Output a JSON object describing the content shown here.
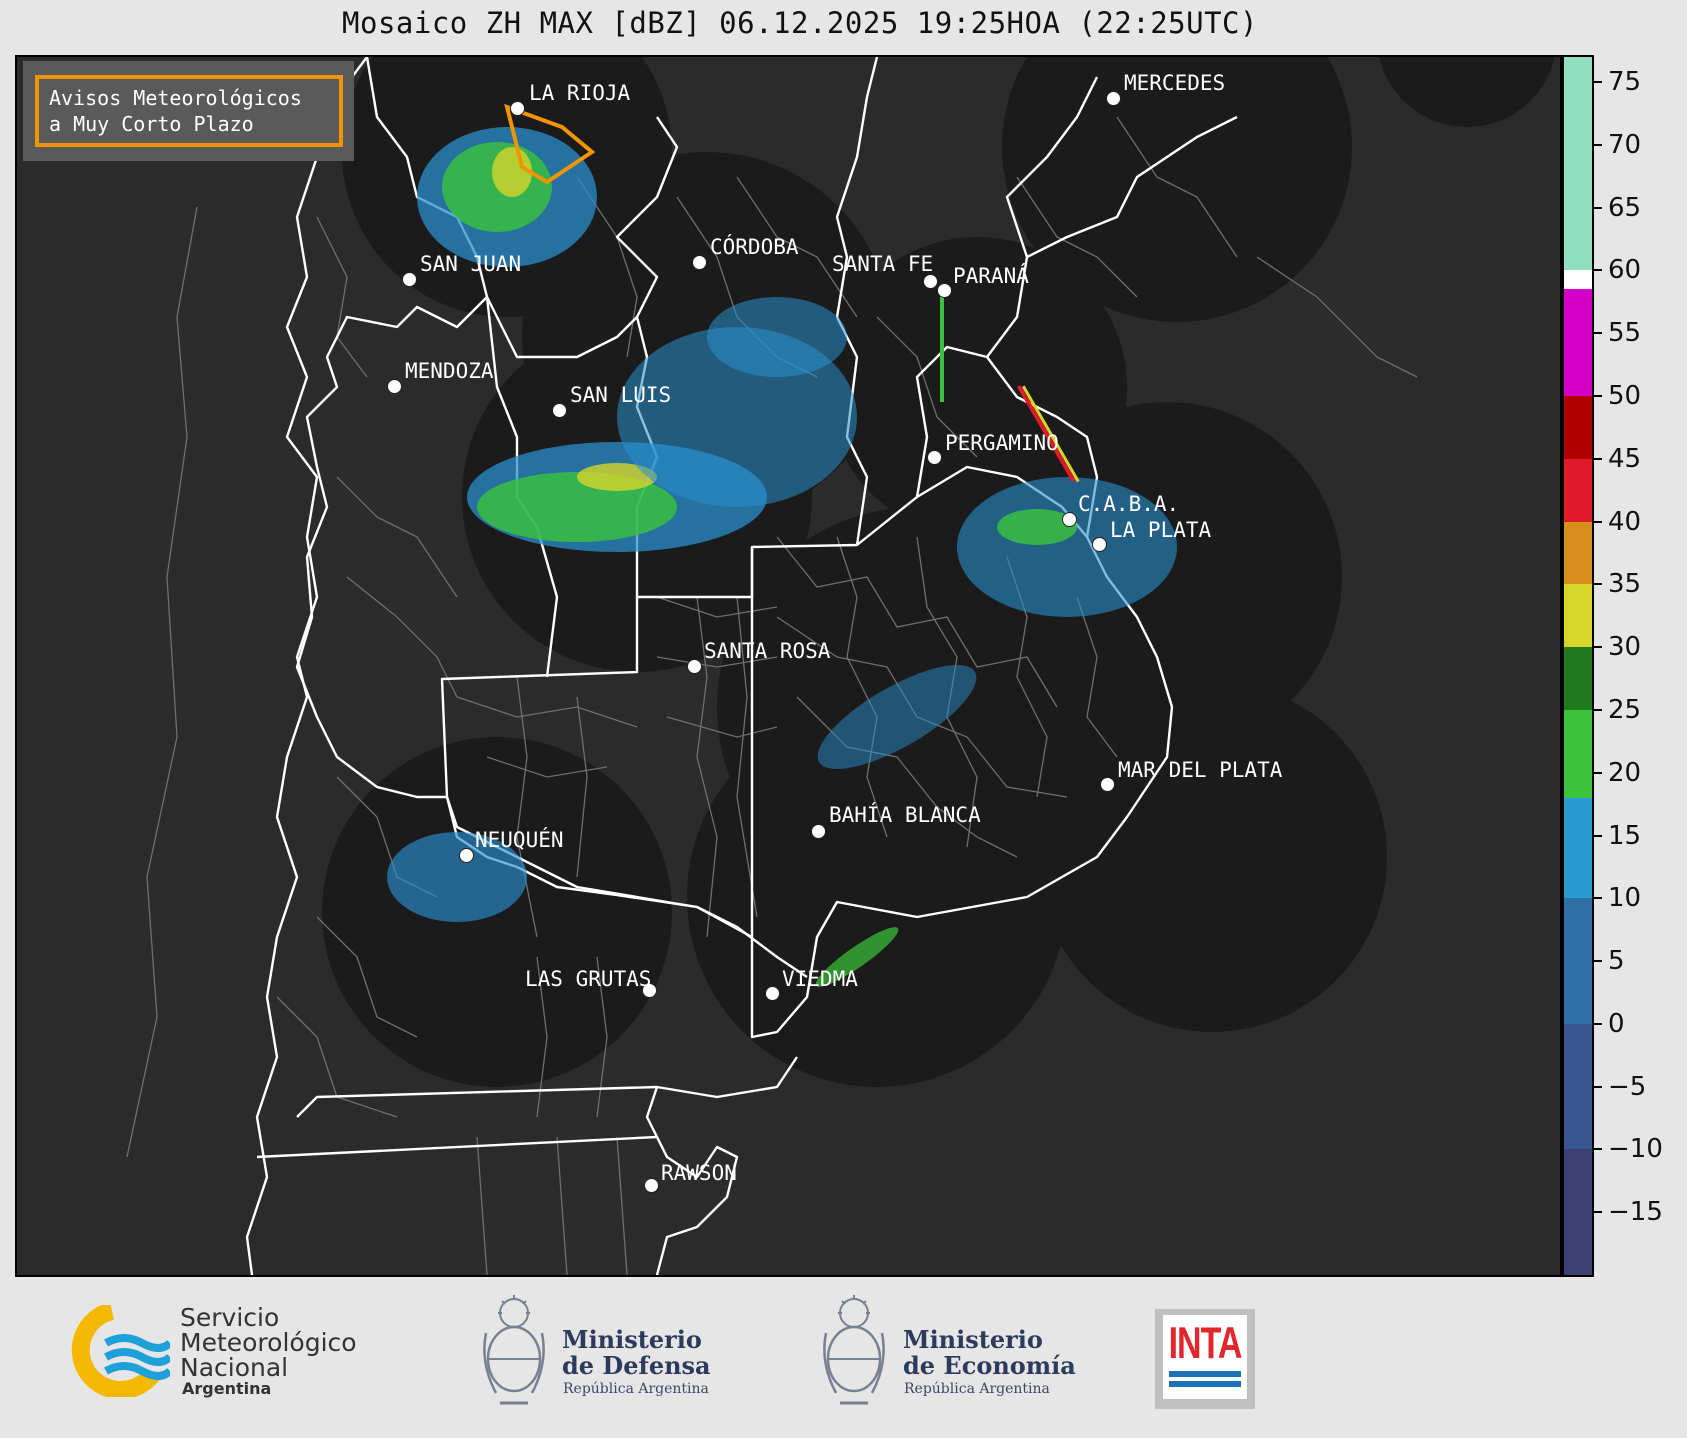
{
  "title": "Mosaico ZH MAX [dBZ] 06.12.2025 19:25HOA (22:25UTC)",
  "alert_box": {
    "line1": "Avisos Meteorológicos",
    "line2": "a Muy Corto Plazo",
    "border_color": "#f29400"
  },
  "cities": [
    {
      "name": "LA RIOJA"
    },
    {
      "name": "MERCEDES"
    },
    {
      "name": "CÓRDOBA"
    },
    {
      "name": "SAN JUAN"
    },
    {
      "name": "SANTA FE"
    },
    {
      "name": "PARANÁ"
    },
    {
      "name": "MENDOZA"
    },
    {
      "name": "SAN LUIS"
    },
    {
      "name": "PERGAMINO"
    },
    {
      "name": "C.A.B.A."
    },
    {
      "name": "LA PLATA"
    },
    {
      "name": "SANTA ROSA"
    },
    {
      "name": "MAR DEL PLATA"
    },
    {
      "name": "BAHÍA BLANCA"
    },
    {
      "name": "NEUQUÉN"
    },
    {
      "name": "LAS GRUTAS"
    },
    {
      "name": "VIEDMA"
    },
    {
      "name": "RAWSON"
    }
  ],
  "colorbar": {
    "unit": "dBZ",
    "min": -20,
    "max": 77,
    "ticks": [
      "75",
      "70",
      "65",
      "60",
      "55",
      "50",
      "45",
      "40",
      "35",
      "30",
      "25",
      "20",
      "15",
      "10",
      "5",
      "0",
      "−5",
      "−10",
      "−15"
    ],
    "tick_values": [
      75,
      70,
      65,
      60,
      55,
      50,
      45,
      40,
      35,
      30,
      25,
      20,
      15,
      10,
      5,
      0,
      -5,
      -10,
      -15
    ],
    "segments": [
      {
        "from": 60,
        "to": 77,
        "color": "#8fe0c0"
      },
      {
        "from": 58.5,
        "to": 60,
        "color": "#ffffff"
      },
      {
        "from": 50,
        "to": 58.5,
        "color": "#d400c8"
      },
      {
        "from": 45,
        "to": 50,
        "color": "#b00000"
      },
      {
        "from": 40,
        "to": 45,
        "color": "#e01a2a"
      },
      {
        "from": 35,
        "to": 40,
        "color": "#d88f1c"
      },
      {
        "from": 30,
        "to": 35,
        "color": "#d6d62a"
      },
      {
        "from": 25,
        "to": 30,
        "color": "#1f7a1f"
      },
      {
        "from": 18,
        "to": 25,
        "color": "#3bc43b"
      },
      {
        "from": 10,
        "to": 18,
        "color": "#2a9bd0"
      },
      {
        "from": 0,
        "to": 10,
        "color": "#2f6fa6"
      },
      {
        "from": -10,
        "to": 0,
        "color": "#3a5690"
      },
      {
        "from": -20,
        "to": -10,
        "color": "#3c3f72"
      }
    ]
  },
  "footer": {
    "smn": {
      "line1": "Servicio",
      "line2": "Meteorológico",
      "line3": "Nacional",
      "line4": "Argentina"
    },
    "defensa": {
      "line1": "Ministerio",
      "line2": "de Defensa",
      "line3": "República Argentina"
    },
    "economia": {
      "line1": "Ministerio",
      "line2": "de Economía",
      "line3": "República Argentina"
    },
    "inta": "INTA"
  },
  "colors": {
    "map_bg": "#2b2b2b",
    "radar_disc": "#1b1b1b",
    "province_border": "#ffffff",
    "department_border": "#777777",
    "echo_weak": "#2a8fce",
    "echo_moderate": "#3bc43b",
    "echo_strong": "#d6d62a"
  }
}
